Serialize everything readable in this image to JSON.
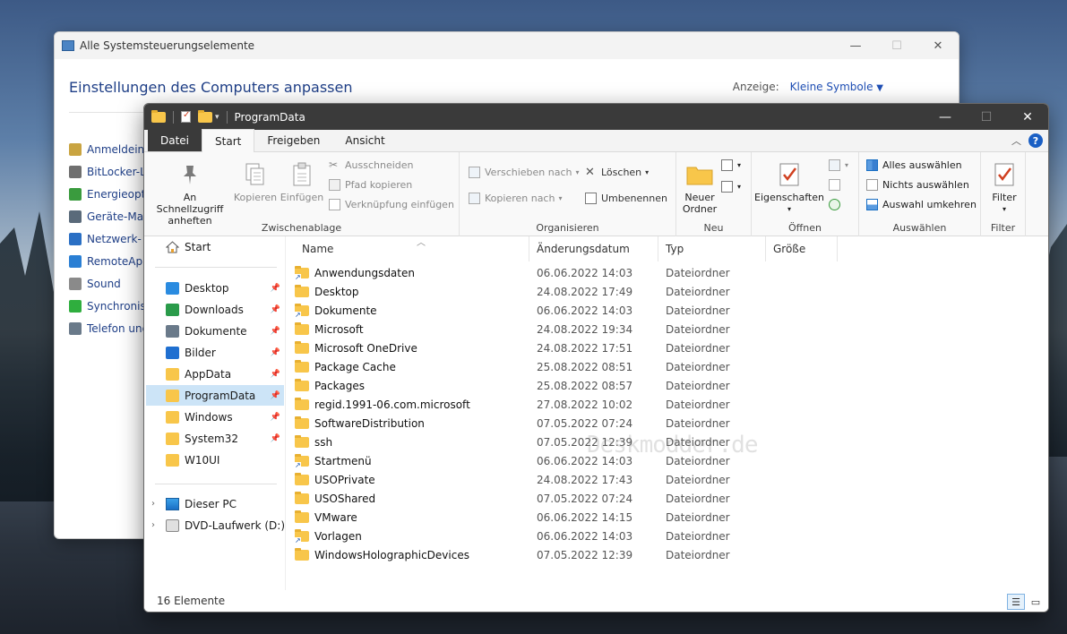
{
  "control_panel": {
    "title": "Alle Systemsteuerungselemente",
    "heading": "Einstellungen des Computers anpassen",
    "view_label": "Anzeige:",
    "view_value": "Kleine Symbole",
    "items": [
      {
        "label": "Anmeldeinf",
        "color": "#c9a441"
      },
      {
        "label": "BitLocker-La",
        "color": "#6f6f6f"
      },
      {
        "label": "Energieoptic",
        "color": "#3a9b3e"
      },
      {
        "label": "Geräte-Man",
        "color": "#5a6a7a"
      },
      {
        "label": "Netzwerk- u",
        "color": "#2a6fc4"
      },
      {
        "label": "RemoteApp",
        "color": "#2a7fd4"
      },
      {
        "label": "Sound",
        "color": "#8a8a8a"
      },
      {
        "label": "Synchronisi",
        "color": "#2fae3e"
      },
      {
        "label": "Telefon und",
        "color": "#6a7a8a"
      }
    ]
  },
  "explorer": {
    "title": "ProgramData",
    "tabs": {
      "file": "Datei",
      "start": "Start",
      "share": "Freigeben",
      "view": "Ansicht"
    },
    "ribbon": {
      "clipboard": {
        "pin_line1": "An Schnellzugriff",
        "pin_line2": "anheften",
        "copy": "Kopieren",
        "paste": "Einfügen",
        "cut": "Ausschneiden",
        "copy_path": "Pfad kopieren",
        "paste_shortcut": "Verknüpfung einfügen",
        "label": "Zwischenablage"
      },
      "organize": {
        "move_to": "Verschieben nach",
        "copy_to": "Kopieren nach",
        "delete": "Löschen",
        "rename": "Umbenennen",
        "label": "Organisieren"
      },
      "new": {
        "folder_line1": "Neuer",
        "folder_line2": "Ordner",
        "label": "Neu"
      },
      "open": {
        "properties": "Eigenschaften",
        "label": "Öffnen"
      },
      "select": {
        "all": "Alles auswählen",
        "none": "Nichts auswählen",
        "invert": "Auswahl umkehren",
        "label": "Auswählen"
      },
      "filter": {
        "button": "Filter",
        "label": "Filter"
      }
    },
    "nav": {
      "start": "Start",
      "pinned": [
        {
          "label": "Desktop",
          "color": "#2a8be0"
        },
        {
          "label": "Downloads",
          "color": "#2a9b4a"
        },
        {
          "label": "Dokumente",
          "color": "#6a7a8a"
        },
        {
          "label": "Bilder",
          "color": "#1f6fd0"
        },
        {
          "label": "AppData",
          "color": "#f8c64a"
        },
        {
          "label": "ProgramData",
          "color": "#f8c64a"
        },
        {
          "label": "Windows",
          "color": "#f8c64a"
        },
        {
          "label": "System32",
          "color": "#f8c64a"
        },
        {
          "label": "W10UI",
          "color": "#f8c64a"
        }
      ],
      "this_pc": "Dieser PC",
      "dvd": "DVD-Laufwerk (D:) C"
    },
    "columns": {
      "name": "Name",
      "date": "Änderungsdatum",
      "type": "Typ",
      "size": "Größe"
    },
    "files": [
      {
        "name": "Anwendungsdaten",
        "date": "06.06.2022 14:03",
        "type": "Dateiordner",
        "shortcut": true
      },
      {
        "name": "Desktop",
        "date": "24.08.2022 17:49",
        "type": "Dateiordner",
        "shortcut": false
      },
      {
        "name": "Dokumente",
        "date": "06.06.2022 14:03",
        "type": "Dateiordner",
        "shortcut": true
      },
      {
        "name": "Microsoft",
        "date": "24.08.2022 19:34",
        "type": "Dateiordner",
        "shortcut": false
      },
      {
        "name": "Microsoft OneDrive",
        "date": "24.08.2022 17:51",
        "type": "Dateiordner",
        "shortcut": false
      },
      {
        "name": "Package Cache",
        "date": "25.08.2022 08:51",
        "type": "Dateiordner",
        "shortcut": false
      },
      {
        "name": "Packages",
        "date": "25.08.2022 08:57",
        "type": "Dateiordner",
        "shortcut": false
      },
      {
        "name": "regid.1991-06.com.microsoft",
        "date": "27.08.2022 10:02",
        "type": "Dateiordner",
        "shortcut": false
      },
      {
        "name": "SoftwareDistribution",
        "date": "07.05.2022 07:24",
        "type": "Dateiordner",
        "shortcut": false
      },
      {
        "name": "ssh",
        "date": "07.05.2022 12:39",
        "type": "Dateiordner",
        "shortcut": false
      },
      {
        "name": "Startmenü",
        "date": "06.06.2022 14:03",
        "type": "Dateiordner",
        "shortcut": true
      },
      {
        "name": "USOPrivate",
        "date": "24.08.2022 17:43",
        "type": "Dateiordner",
        "shortcut": false
      },
      {
        "name": "USOShared",
        "date": "07.05.2022 07:24",
        "type": "Dateiordner",
        "shortcut": false
      },
      {
        "name": "VMware",
        "date": "06.06.2022 14:15",
        "type": "Dateiordner",
        "shortcut": false
      },
      {
        "name": "Vorlagen",
        "date": "06.06.2022 14:03",
        "type": "Dateiordner",
        "shortcut": true
      },
      {
        "name": "WindowsHolographicDevices",
        "date": "07.05.2022 12:39",
        "type": "Dateiordner",
        "shortcut": false
      }
    ],
    "status": "16 Elemente",
    "watermark": "Deskmodder.de"
  }
}
